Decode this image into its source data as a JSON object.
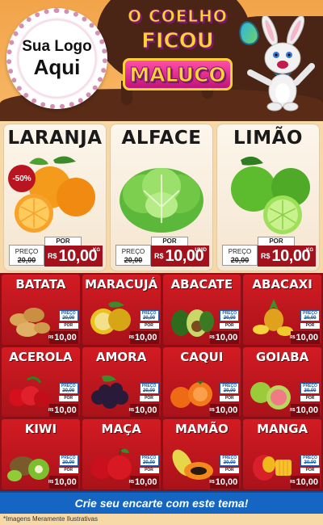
{
  "logo": {
    "line1": "Sua Logo",
    "line2": "Aqui"
  },
  "title": {
    "top": "O COELHO",
    "middle": "FICOU",
    "bottom": "MALUCO"
  },
  "featured": [
    {
      "name": "LARANJA",
      "discount": "-50%",
      "preco_label": "PREÇO",
      "old_price": "20,00",
      "por_label": "POR",
      "currency": "R$",
      "price": "10,00",
      "unit": "KG",
      "image": "orange"
    },
    {
      "name": "ALFACE",
      "discount": "",
      "preco_label": "PREÇO",
      "old_price": "20,00",
      "por_label": "POR",
      "currency": "R$",
      "price": "10,00",
      "unit": "UNID",
      "image": "lettuce"
    },
    {
      "name": "LIMÃO",
      "discount": "",
      "preco_label": "PREÇO",
      "old_price": "20,00",
      "por_label": "POR",
      "currency": "R$",
      "price": "10,00",
      "unit": "KG",
      "image": "lime"
    }
  ],
  "products": [
    {
      "name": "BATATA",
      "image": "potato"
    },
    {
      "name": "MARACUJÁ",
      "image": "passionfruit"
    },
    {
      "name": "ABACATE",
      "image": "avocado"
    },
    {
      "name": "ABACAXI",
      "image": "pineapple"
    },
    {
      "name": "ACEROLA",
      "image": "acerola"
    },
    {
      "name": "AMORA",
      "image": "blackberry"
    },
    {
      "name": "CAQUI",
      "image": "persimmon"
    },
    {
      "name": "GOIABA",
      "image": "guava"
    },
    {
      "name": "KIWI",
      "image": "kiwi"
    },
    {
      "name": "MAÇA",
      "image": "apple"
    },
    {
      "name": "MAMÃO",
      "image": "papaya"
    },
    {
      "name": "MANGA",
      "image": "mango"
    }
  ],
  "small_price": {
    "preco_label": "PREÇO",
    "old_price": "20,00",
    "por_label": "POR",
    "currency": "R$",
    "price": "10,00"
  },
  "cta": "Crie seu encarte com este tema!",
  "disclaimer": "*Imagens Meramente Ilustrativas",
  "colors": {
    "red": "#d31b22",
    "dark_red": "#8a0f16",
    "blue": "#1466c2",
    "cream": "#fdf6ec",
    "orange_bg": "#f2a44a",
    "chocolate": "#4a2414"
  }
}
